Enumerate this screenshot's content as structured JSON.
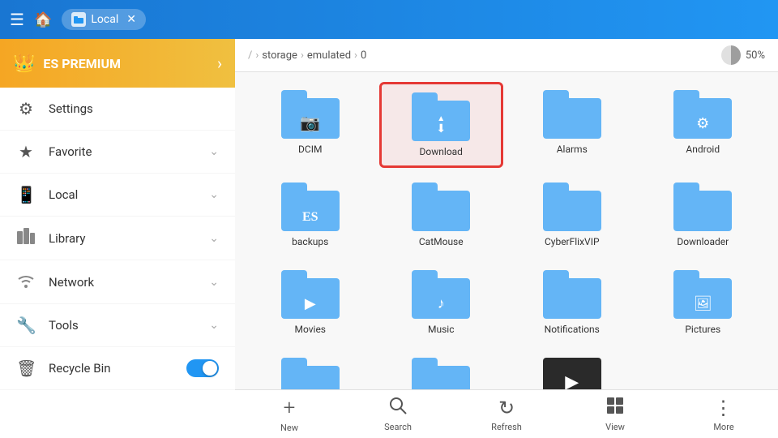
{
  "topbar": {
    "tab_label": "Local",
    "home_icon": "🏠"
  },
  "breadcrumb": {
    "items": [
      "/",
      "storage",
      "emulated",
      "0"
    ],
    "storage_percent": "50%"
  },
  "sidebar": {
    "premium_label": "ES PREMIUM",
    "items": [
      {
        "id": "settings",
        "label": "Settings",
        "icon": "⚙️",
        "has_chevron": false,
        "has_toggle": false
      },
      {
        "id": "favorite",
        "label": "Favorite",
        "icon": "⭐",
        "has_chevron": true,
        "has_toggle": false
      },
      {
        "id": "local",
        "label": "Local",
        "icon": "📱",
        "has_chevron": true,
        "has_toggle": false
      },
      {
        "id": "library",
        "label": "Library",
        "icon": "📚",
        "has_chevron": true,
        "has_toggle": false
      },
      {
        "id": "network",
        "label": "Network",
        "icon": "📡",
        "has_chevron": true,
        "has_toggle": false
      },
      {
        "id": "tools",
        "label": "Tools",
        "icon": "🔧",
        "has_chevron": true,
        "has_toggle": false
      },
      {
        "id": "recycle-bin",
        "label": "Recycle Bin",
        "icon": "🗑️",
        "has_chevron": false,
        "has_toggle": true
      }
    ]
  },
  "files": [
    {
      "id": "dcim",
      "name": "DCIM",
      "type": "folder",
      "overlay": "camera",
      "selected": false
    },
    {
      "id": "download",
      "name": "Download",
      "type": "folder",
      "overlay": "download",
      "selected": true
    },
    {
      "id": "alarms",
      "name": "Alarms",
      "type": "folder",
      "overlay": "none",
      "selected": false
    },
    {
      "id": "android",
      "name": "Android",
      "type": "folder",
      "overlay": "gear",
      "selected": false
    },
    {
      "id": "backups",
      "name": "backups",
      "type": "folder",
      "overlay": "es",
      "selected": false
    },
    {
      "id": "catmouse",
      "name": "CatMouse",
      "type": "folder",
      "overlay": "none",
      "selected": false
    },
    {
      "id": "cyberflixvip",
      "name": "CyberFlixVIP",
      "type": "folder",
      "overlay": "none",
      "selected": false
    },
    {
      "id": "downloader",
      "name": "Downloader",
      "type": "folder",
      "overlay": "none",
      "selected": false
    },
    {
      "id": "movies",
      "name": "Movies",
      "type": "folder",
      "overlay": "play",
      "selected": false
    },
    {
      "id": "music",
      "name": "Music",
      "type": "folder",
      "overlay": "music",
      "selected": false
    },
    {
      "id": "notifications",
      "name": "Notifications",
      "type": "folder",
      "overlay": "none",
      "selected": false
    },
    {
      "id": "pictures",
      "name": "Pictures",
      "type": "folder",
      "overlay": "image",
      "selected": false
    },
    {
      "id": "folder13",
      "name": "",
      "type": "folder-plain",
      "overlay": "none",
      "selected": false
    },
    {
      "id": "folder14",
      "name": "",
      "type": "folder-plain",
      "overlay": "none",
      "selected": false
    },
    {
      "id": "video-thumb",
      "name": "",
      "type": "thumb",
      "overlay": "none",
      "selected": false
    }
  ],
  "toolbar": {
    "items": [
      {
        "id": "new",
        "label": "New",
        "icon": "+"
      },
      {
        "id": "search",
        "label": "Search",
        "icon": "🔍"
      },
      {
        "id": "refresh",
        "label": "Refresh",
        "icon": "↻"
      },
      {
        "id": "view",
        "label": "View",
        "icon": "⊞"
      },
      {
        "id": "more",
        "label": "More",
        "icon": "⋮"
      }
    ]
  }
}
